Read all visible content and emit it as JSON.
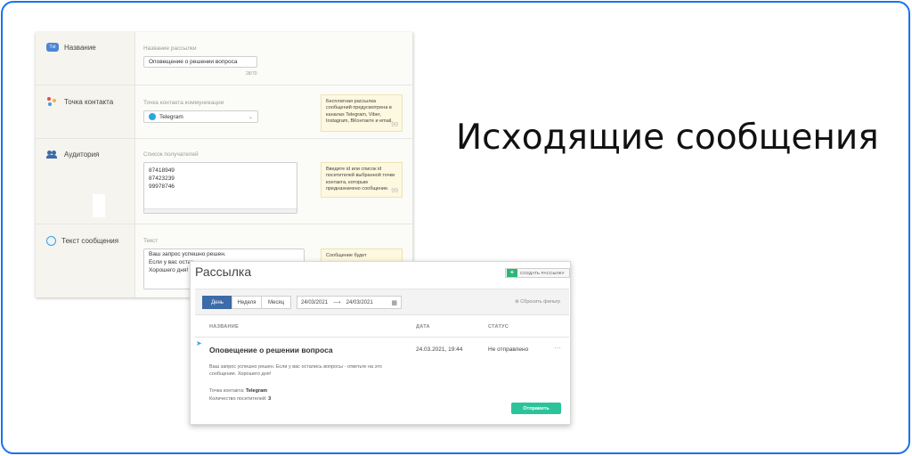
{
  "headline": "Исходящие сообщения",
  "form": {
    "name_row": {
      "icon_text": "Txt",
      "label": "Название",
      "caption": "Название рассылки",
      "value": "Оповещение о решении вопроса",
      "counter": "28/70"
    },
    "contact_row": {
      "label": "Точка контакта",
      "caption": "Точка контакта коммуникации",
      "value": "Telegram",
      "hint": "Бесплатная рассылка сообщений предусмотрена в каналах Telegram, Viber, Instagram, ВКонтакте и email."
    },
    "audience_row": {
      "label": "Аудитория",
      "caption": "Список получателей",
      "recipients": [
        "87418949",
        "87423239",
        "99978746"
      ],
      "hint": "Введите id или список id посетителей выбранной точки контакта, которым предназначено сообщение."
    },
    "text_row": {
      "label": "Текст сообщения",
      "caption": "Текст",
      "line1": "Ваш запрос успешно решен.",
      "line2": "Если у вас остаг",
      "line3": "Хорошего дня!",
      "hint": "Сообщение будет"
    },
    "quote_mark": "99"
  },
  "list": {
    "title": "Рассылка",
    "create_button": "СОЗДАТЬ РАССЫЛКУ",
    "periods": [
      "День",
      "Неделя",
      "Месяц"
    ],
    "active_period": "День",
    "date_from": "24/03/2021",
    "date_to": "24/03/2021",
    "reset_filter": "Сбросить фильтр",
    "columns": {
      "name": "НАЗВАНИЕ",
      "date": "ДАТА",
      "status": "СТАТУС"
    },
    "row": {
      "name": "Оповещение о решении вопроса",
      "date": "24.03.2021, 19:44",
      "status": "Не отправлено",
      "message_line1": "Ваш запрос успешно решен. Если у вас остались вопросы - ответьте на это",
      "message_line2": "сообщение. Хорошего дня!",
      "contact_label": "Точка контакта:",
      "contact_value": "Telegram",
      "count_label": "Количество посетителей:",
      "count_value": "3",
      "send_button": "Отправить"
    }
  },
  "colors": {
    "frame": "#1a73e8",
    "primary": "#3d6aa8",
    "success": "#2bb673",
    "send": "#2bc49a",
    "telegram": "#2ca5e0",
    "hint_bg": "#fdf8df"
  }
}
